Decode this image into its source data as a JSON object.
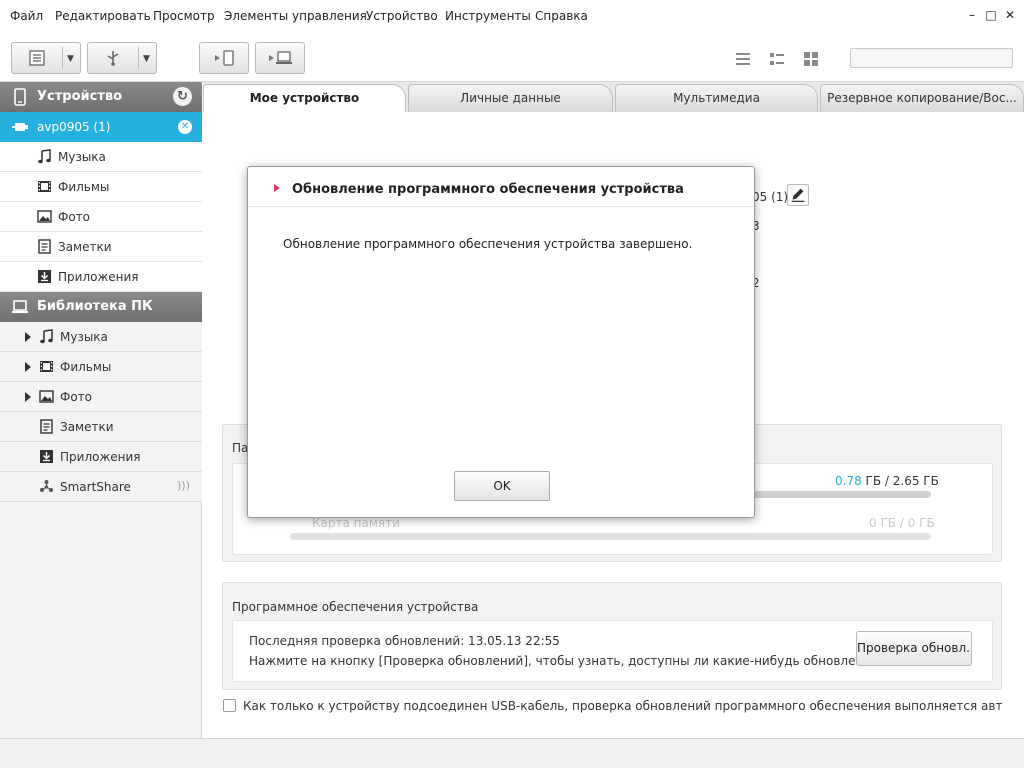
{
  "menu": {
    "items": [
      "Файл",
      "Редактировать",
      "Просмотр",
      "Элементы управления",
      "Устройство",
      "Инструменты",
      "Справка"
    ]
  },
  "window_controls": {
    "minimize": "–",
    "maximize": "□",
    "close": "✕"
  },
  "sidebar": {
    "device_header": "Устройство",
    "device_name": "avp0905 (1)",
    "device_items": [
      "Музыка",
      "Фильмы",
      "Фото",
      "Заметки",
      "Приложения"
    ],
    "library_header": "Библиотека ПК",
    "library_items": [
      "Музыка",
      "Фильмы",
      "Фото",
      "Заметки",
      "Приложения",
      "SmartShare"
    ]
  },
  "tabs": [
    "Мое устройство",
    "Личные данные",
    "Мультимедиа",
    "Резервное копирование/Вос..."
  ],
  "device_info": {
    "name_partial": "05 (1)",
    "line2_partial": "3",
    "line3_partial": "2"
  },
  "memory": {
    "title_partial": "Па",
    "internal_used": "0.78",
    "internal_rest": " ГБ / 2.65 ГБ",
    "internal_fraction": 0.29,
    "card_label": "Карта памяти",
    "card_value": "0 ГБ / 0 ГБ"
  },
  "software": {
    "title": "Программное обеспечения устройства",
    "last_check": "Последняя проверка обновлений: 13.05.13 22:55",
    "hint": "Нажмите на кнопку [Проверка обновлений], чтобы узнать, доступны ли какие-нибудь обновления.",
    "check_button": "Проверка обновл..."
  },
  "auto_check_label": "Как только к устройству подсоединен USB-кабель, проверка обновлений программного обеспечения выполняется автоматиче",
  "dialog": {
    "title": "Обновление программного обеспечения устройства",
    "message": "Обновление программного обеспечения устройства завершено.",
    "ok": "OK"
  },
  "colors": {
    "accent": "#26b0dd",
    "dialog_marker": "#d8355f"
  }
}
